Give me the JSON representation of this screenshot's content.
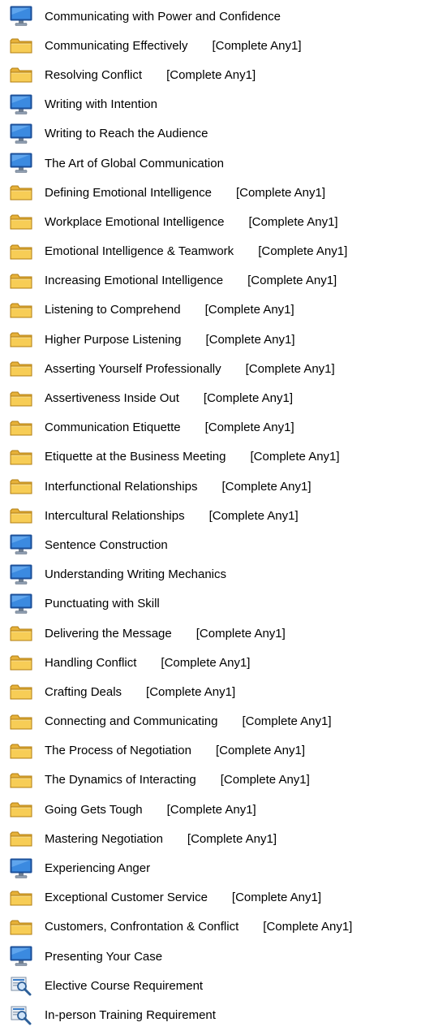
{
  "items": [
    {
      "type": "course",
      "label": "Communicating with Power and Confidence",
      "suffix": ""
    },
    {
      "type": "folder",
      "label": "Communicating Effectively",
      "suffix": "[Complete Any1]"
    },
    {
      "type": "folder",
      "label": "Resolving Conflict",
      "suffix": "[Complete Any1]"
    },
    {
      "type": "course",
      "label": "Writing with Intention",
      "suffix": ""
    },
    {
      "type": "course",
      "label": "Writing to Reach the Audience",
      "suffix": ""
    },
    {
      "type": "course",
      "label": "The Art of Global Communication",
      "suffix": ""
    },
    {
      "type": "folder",
      "label": "Defining Emotional Intelligence",
      "suffix": "[Complete Any1]"
    },
    {
      "type": "folder",
      "label": "Workplace Emotional Intelligence",
      "suffix": "[Complete Any1]"
    },
    {
      "type": "folder",
      "label": "Emotional Intelligence & Teamwork",
      "suffix": "[Complete Any1]"
    },
    {
      "type": "folder",
      "label": "Increasing Emotional Intelligence",
      "suffix": "[Complete Any1]"
    },
    {
      "type": "folder",
      "label": "Listening to Comprehend",
      "suffix": "[Complete Any1]"
    },
    {
      "type": "folder",
      "label": "Higher Purpose Listening",
      "suffix": "[Complete Any1]"
    },
    {
      "type": "folder",
      "label": "Asserting Yourself Professionally",
      "suffix": "[Complete Any1]"
    },
    {
      "type": "folder",
      "label": "Assertiveness Inside Out",
      "suffix": "[Complete Any1]"
    },
    {
      "type": "folder",
      "label": "Communication Etiquette",
      "suffix": "[Complete Any1]"
    },
    {
      "type": "folder",
      "label": "Etiquette at the Business Meeting",
      "suffix": "[Complete Any1]"
    },
    {
      "type": "folder",
      "label": "Interfunctional Relationships",
      "suffix": "[Complete Any1]"
    },
    {
      "type": "folder",
      "label": "Intercultural Relationships",
      "suffix": "[Complete Any1]"
    },
    {
      "type": "course",
      "label": "Sentence Construction",
      "suffix": ""
    },
    {
      "type": "course",
      "label": "Understanding Writing Mechanics",
      "suffix": ""
    },
    {
      "type": "course",
      "label": "Punctuating with Skill",
      "suffix": ""
    },
    {
      "type": "folder",
      "label": "Delivering the Message",
      "suffix": "[Complete Any1]"
    },
    {
      "type": "folder",
      "label": "Handling Conflict",
      "suffix": "[Complete Any1]"
    },
    {
      "type": "folder",
      "label": "Crafting Deals",
      "suffix": "[Complete Any1]"
    },
    {
      "type": "folder",
      "label": "Connecting and Communicating",
      "suffix": "[Complete Any1]"
    },
    {
      "type": "folder",
      "label": "The Process of Negotiation",
      "suffix": "[Complete Any1]"
    },
    {
      "type": "folder",
      "label": "The Dynamics of Interacting",
      "suffix": "[Complete Any1]"
    },
    {
      "type": "folder",
      "label": "Going Gets Tough",
      "suffix": "[Complete Any1]"
    },
    {
      "type": "folder",
      "label": "Mastering Negotiation",
      "suffix": "[Complete Any1]"
    },
    {
      "type": "course",
      "label": "Experiencing Anger",
      "suffix": ""
    },
    {
      "type": "folder",
      "label": "Exceptional Customer Service",
      "suffix": "[Complete Any1]"
    },
    {
      "type": "folder",
      "label": "Customers, Confrontation & Conflict",
      "suffix": "[Complete Any1]"
    },
    {
      "type": "course",
      "label": "Presenting Your Case",
      "suffix": ""
    },
    {
      "type": "requirement",
      "label": "Elective Course Requirement",
      "suffix": ""
    },
    {
      "type": "requirement",
      "label": "In-person Training Requirement",
      "suffix": ""
    }
  ],
  "icons": {
    "course": "computer-monitor-icon",
    "folder": "folder-icon",
    "requirement": "requirement-search-icon"
  },
  "colors": {
    "folder_fill": "#f5c74a",
    "folder_edge": "#c08a12",
    "monitor_screen": "#2f7fd6",
    "monitor_frame": "#1b4f99",
    "requirement_accent": "#3a7ec9"
  }
}
